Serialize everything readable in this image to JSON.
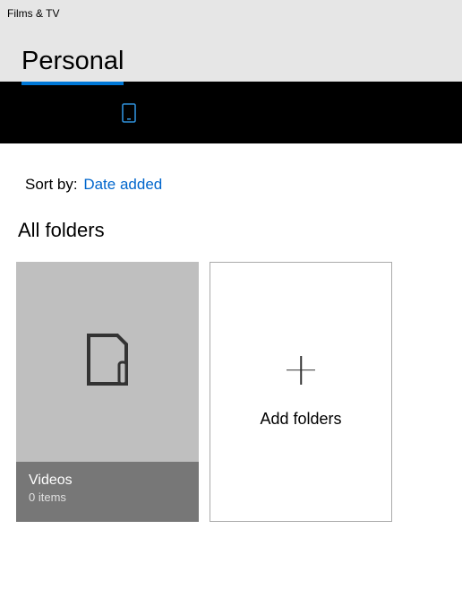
{
  "window": {
    "title": "Films & TV"
  },
  "tabs": {
    "active_label": "Personal"
  },
  "sort": {
    "label": "Sort by:",
    "value": "Date added"
  },
  "section": {
    "title": "All folders"
  },
  "folders": [
    {
      "name": "Videos",
      "count_label": "0 items"
    }
  ],
  "add_tile": {
    "label": "Add folders"
  },
  "colors": {
    "accent": "#0078d7"
  }
}
